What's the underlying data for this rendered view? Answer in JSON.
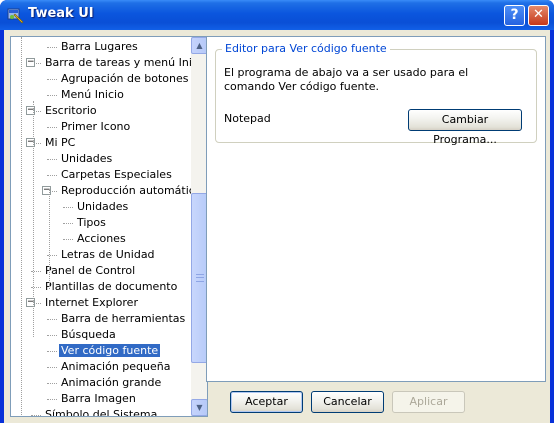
{
  "window": {
    "title": "Tweak UI",
    "help_glyph": "?",
    "close_glyph": "✕"
  },
  "tree": {
    "items": [
      {
        "label": "Barra Lugares",
        "depth": 2
      },
      {
        "label": "Barra de tareas y menú Inicio",
        "depth": 1,
        "expander": "−"
      },
      {
        "label": "Agrupación de botones",
        "depth": 2
      },
      {
        "label": "Menú Inicio",
        "depth": 2
      },
      {
        "label": "Escritorio",
        "depth": 1,
        "expander": "−"
      },
      {
        "label": "Primer Icono",
        "depth": 2
      },
      {
        "label": "Mi PC",
        "depth": 1,
        "expander": "−"
      },
      {
        "label": "Unidades",
        "depth": 2
      },
      {
        "label": "Carpetas Especiales",
        "depth": 2
      },
      {
        "label": "Reproducción automática",
        "depth": 2,
        "expander": "−"
      },
      {
        "label": "Unidades",
        "depth": 3
      },
      {
        "label": "Tipos",
        "depth": 3
      },
      {
        "label": "Acciones",
        "depth": 3
      },
      {
        "label": "Letras de Unidad",
        "depth": 2
      },
      {
        "label": "Panel de Control",
        "depth": 1
      },
      {
        "label": "Plantillas de documento",
        "depth": 1
      },
      {
        "label": "Internet Explorer",
        "depth": 1,
        "expander": "−"
      },
      {
        "label": "Barra de herramientas",
        "depth": 2
      },
      {
        "label": "Búsqueda",
        "depth": 2
      },
      {
        "label": "Ver código fuente",
        "depth": 2,
        "selected": true
      },
      {
        "label": "Animación pequeña",
        "depth": 2
      },
      {
        "label": "Animación grande",
        "depth": 2
      },
      {
        "label": "Barra Imagen",
        "depth": 2
      },
      {
        "label": "Símbolo del Sistema",
        "depth": 1
      }
    ],
    "scroll_up_glyph": "▲",
    "scroll_down_glyph": "▼"
  },
  "panel": {
    "group_title": "Editor para Ver código fuente",
    "description": "El programa de abajo va a ser usado para el comando Ver código fuente.",
    "program": "Notepad",
    "change_button": "Cambiar Programa..."
  },
  "footer": {
    "ok": "Aceptar",
    "cancel": "Cancelar",
    "apply": "Aplicar"
  }
}
